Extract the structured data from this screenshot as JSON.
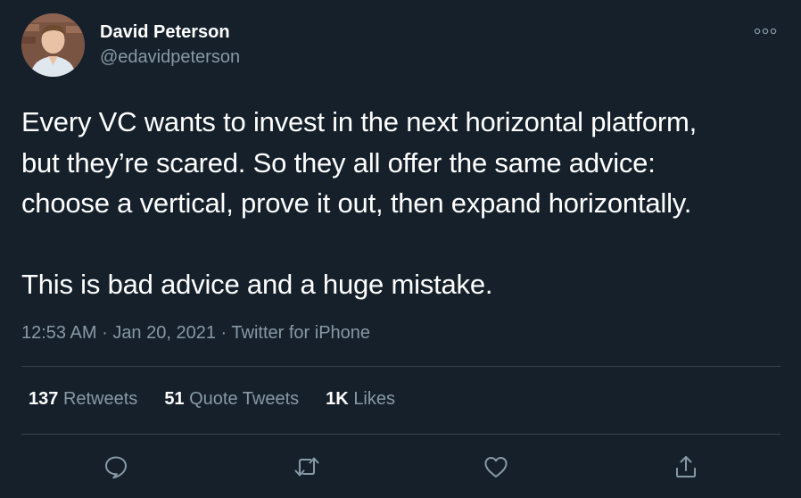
{
  "author": {
    "name": "David Peterson",
    "handle": "@edavidpeterson"
  },
  "tweet": {
    "text": "Every VC wants to invest in the next horizontal platform,\nbut they’re scared. So they all offer the same advice:\nchoose a vertical, prove it out, then expand horizontally.\n\nThis is bad advice and a huge mistake.",
    "time": "12:53 AM",
    "separator": "·",
    "date": "Jan 20, 2021",
    "source": "Twitter for iPhone"
  },
  "stats": {
    "retweets_count": "137",
    "retweets_label": "Retweets",
    "quotes_count": "51",
    "quotes_label": "Quote Tweets",
    "likes_count": "1K",
    "likes_label": "Likes"
  },
  "actions": [
    "reply-icon",
    "retweet-icon",
    "like-icon",
    "share-icon"
  ],
  "colors": {
    "background": "#15202b",
    "text": "#ffffff",
    "secondary": "#8899a6",
    "divider": "#38444d"
  }
}
